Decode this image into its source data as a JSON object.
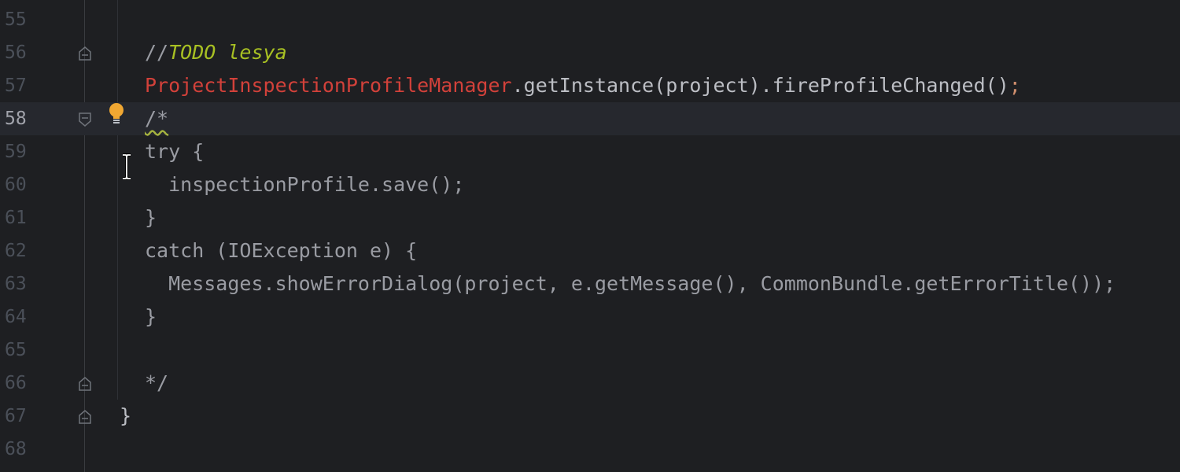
{
  "editor": {
    "lines": [
      {
        "num": "55",
        "text": ""
      },
      {
        "num": "56",
        "prefix": "//",
        "todo": "TODO lesya"
      },
      {
        "num": "57",
        "cls": "ProjectInspectionProfileManager",
        "rest": ".getInstance(project).fireProfileChanged()",
        "semi": ";"
      },
      {
        "num": "58",
        "text": "/*"
      },
      {
        "num": "59",
        "text": "try {"
      },
      {
        "num": "60",
        "text": "  inspectionProfile.save();"
      },
      {
        "num": "61",
        "text": "}"
      },
      {
        "num": "62",
        "text": "catch (IOException e) {"
      },
      {
        "num": "63",
        "text": "  Messages.showErrorDialog(project, e.getMessage(), CommonBundle.getErrorTitle());"
      },
      {
        "num": "64",
        "text": "}"
      },
      {
        "num": "65",
        "text": ""
      },
      {
        "num": "66",
        "text": "*/"
      },
      {
        "num": "67",
        "text": "}"
      },
      {
        "num": "68",
        "text": ""
      }
    ],
    "current_line": "58",
    "colors": {
      "background": "#1e1f22",
      "current_line_bg": "#26282e",
      "todo": "#a8c023",
      "error_class": "#d2413a",
      "keyword_semicolon": "#cf8e6d",
      "comment": "#9a9ca3",
      "line_number": "#4b5059",
      "bulb": "#f0a732"
    },
    "icons": {
      "intention": "lightbulb-icon",
      "fold": "fold-marker-icon",
      "cursor": "text-cursor-icon"
    }
  }
}
